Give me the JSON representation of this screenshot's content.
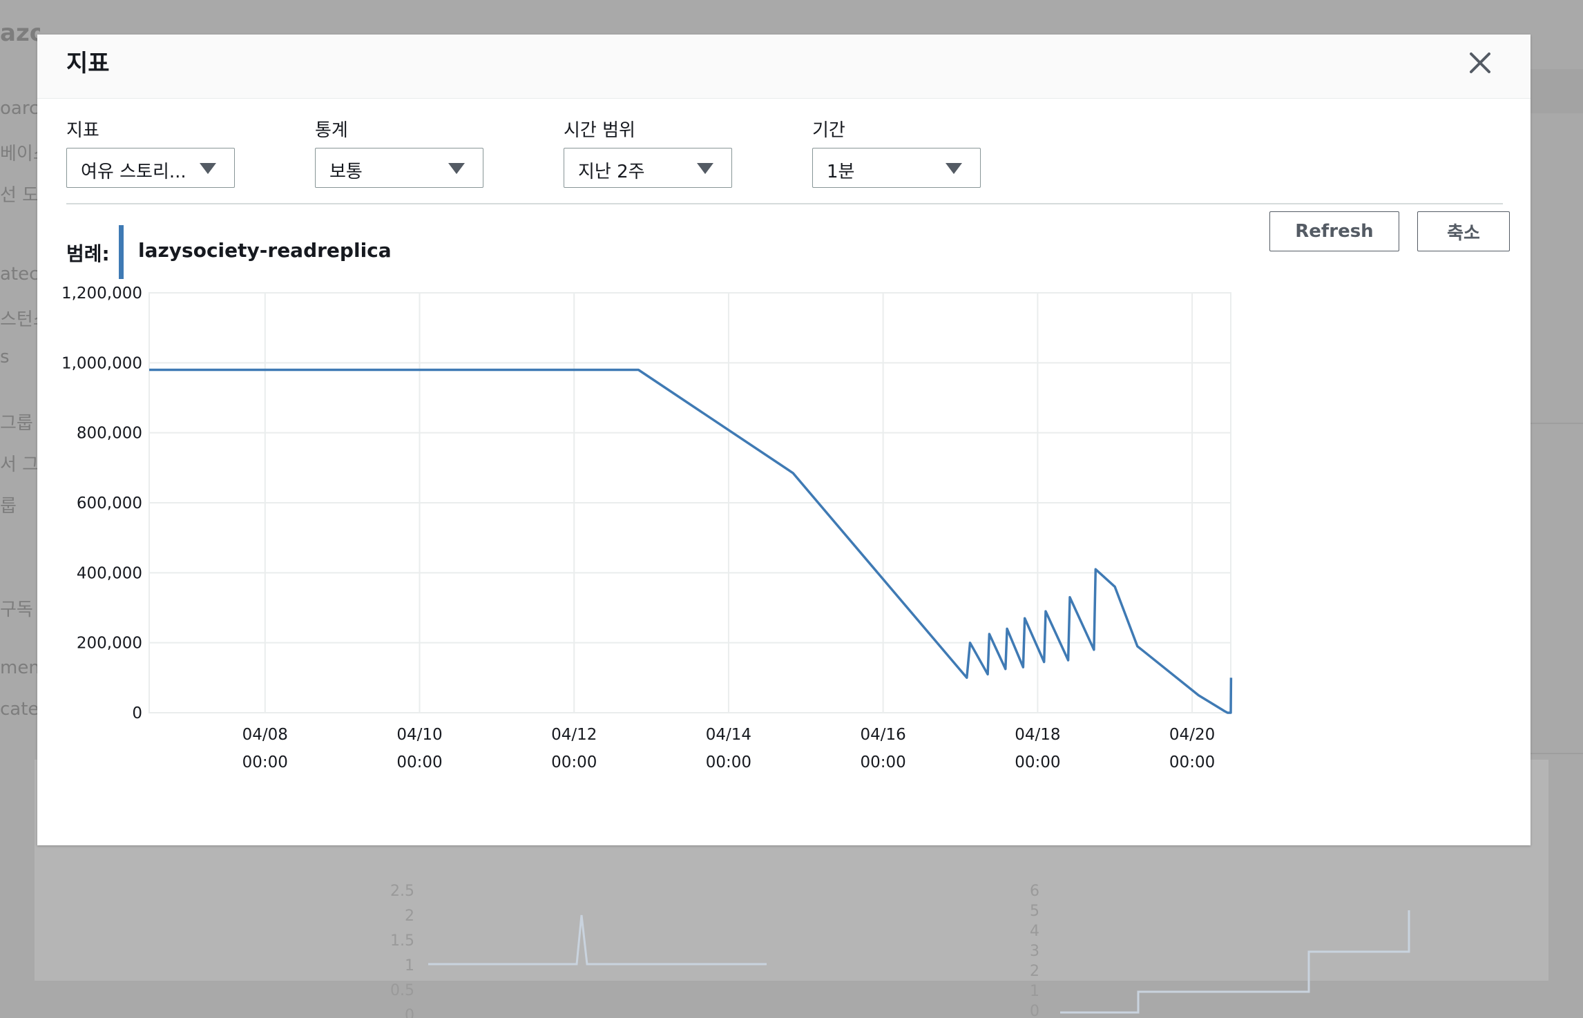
{
  "background": {
    "brand": "azon",
    "sidebar_fragments": [
      "oarc",
      "베이스",
      "선 도",
      "atec",
      "스턴스",
      "s",
      "그룹",
      "서 그룹",
      "룹",
      "구독",
      "men",
      "cate"
    ],
    "charts": [
      {
        "y_ticks": [
          "2.5",
          "2",
          "1.5",
          "1",
          "0.5",
          "0"
        ]
      },
      {
        "y_ticks": [
          "6",
          "5",
          "4",
          "3",
          "2",
          "1",
          "0"
        ]
      }
    ]
  },
  "modal": {
    "title": "지표",
    "close_label": "×",
    "controls": [
      {
        "label": "지표",
        "value": "여유 스토리..."
      },
      {
        "label": "통계",
        "value": "보통"
      },
      {
        "label": "시간 범위",
        "value": "지난 2주"
      },
      {
        "label": "기간",
        "value": "1분"
      }
    ],
    "refresh_label": "Refresh",
    "shrink_label": "축소",
    "legend_title": "범례:",
    "colors": {
      "series": "#3f7ab4",
      "grid": "#eaeded"
    }
  },
  "chart_data": {
    "type": "line",
    "title": "",
    "xlabel": "",
    "ylabel": "",
    "ylim": [
      0,
      1200000
    ],
    "xlim": [
      "2023-04-06 12:00",
      "2023-04-20 12:00"
    ],
    "y_ticks": [
      "1,200,000",
      "1,000,000",
      "800,000",
      "600,000",
      "400,000",
      "200,000",
      "0"
    ],
    "y_tick_values": [
      1200000,
      1000000,
      800000,
      600000,
      400000,
      200000,
      0
    ],
    "x_ticks": [
      {
        "date": "04/08",
        "time": "00:00"
      },
      {
        "date": "04/10",
        "time": "00:00"
      },
      {
        "date": "04/12",
        "time": "00:00"
      },
      {
        "date": "04/14",
        "time": "00:00"
      },
      {
        "date": "04/16",
        "time": "00:00"
      },
      {
        "date": "04/18",
        "time": "00:00"
      },
      {
        "date": "04/20",
        "time": "00:00"
      }
    ],
    "x_tick_values": [
      "2023-04-08 00:00",
      "2023-04-10 00:00",
      "2023-04-12 00:00",
      "2023-04-14 00:00",
      "2023-04-16 00:00",
      "2023-04-18 00:00",
      "2023-04-20 00:00"
    ],
    "grid": true,
    "series": [
      {
        "name": "lazysociety-readreplica",
        "x": [
          "2023-04-06 12:00",
          "2023-04-12 20:00",
          "2023-04-14 20:00",
          "2023-04-17 02:00",
          "2023-04-17 03:00",
          "2023-04-17 08:30",
          "2023-04-17 09:00",
          "2023-04-17 14:00",
          "2023-04-17 14:30",
          "2023-04-17 19:30",
          "2023-04-17 20:00",
          "2023-04-18 02:00",
          "2023-04-18 02:30",
          "2023-04-18 09:30",
          "2023-04-18 10:00",
          "2023-04-18 17:30",
          "2023-04-18 18:00",
          "2023-04-19 00:00",
          "2023-04-19 07:00",
          "2023-04-20 02:00",
          "2023-04-20 10:00",
          "2023-04-20 11:00",
          "2023-04-20 12:00",
          "2023-04-20 12:05"
        ],
        "y": [
          980000,
          980000,
          685000,
          100000,
          200000,
          110000,
          225000,
          125000,
          240000,
          130000,
          270000,
          145000,
          290000,
          150000,
          330000,
          180000,
          410000,
          360000,
          190000,
          50000,
          5000,
          0,
          0,
          100000
        ]
      }
    ]
  }
}
